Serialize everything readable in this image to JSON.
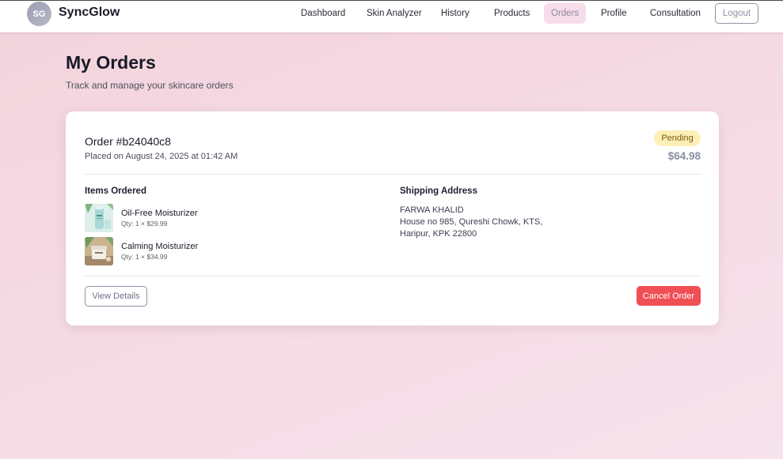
{
  "nav": {
    "logo_initials": "SG",
    "brand": "SyncGlow",
    "links": [
      {
        "label": "Dashboard",
        "active": false
      },
      {
        "label": "Skin Analyzer",
        "active": false
      },
      {
        "label": "History",
        "active": false
      },
      {
        "label": "Products",
        "active": false
      },
      {
        "label": "Orders",
        "active": true
      },
      {
        "label": "Profile",
        "active": false
      },
      {
        "label": "Consultation",
        "active": false
      }
    ],
    "logout_label": "Logout"
  },
  "header": {
    "title": "My Orders",
    "subtitle": "Track and manage your skincare orders"
  },
  "order": {
    "number": "Order #b24040c8",
    "placed_on": "Placed on August 24, 2025 at 01:42 AM",
    "status": "Pending",
    "total": "$64.98",
    "items_heading": "Items Ordered",
    "items": [
      {
        "name": "Oil-Free Moisturizer",
        "qty": "Qty: 1 × $29.99",
        "thumb_icon": "moisturizer-bottle-icon"
      },
      {
        "name": "Calming Moisturizer",
        "qty": "Qty: 1 × $34.99",
        "thumb_icon": "moisturizer-jar-icon"
      }
    ],
    "shipping_heading": "Shipping Address",
    "address": {
      "name": "FARWA KHALID",
      "line1": "House no 985, Qureshi Chowk, KTS,",
      "line2": "Haripur, KPK 22800"
    },
    "view_details_label": "View Details",
    "cancel_label": "Cancel Order"
  },
  "colors": {
    "accent_active_tab": "#f7dcea",
    "status_pending_bg": "#fcf0b6",
    "cancel_button": "#ef4f55",
    "page_background": "#f4d8e2"
  }
}
